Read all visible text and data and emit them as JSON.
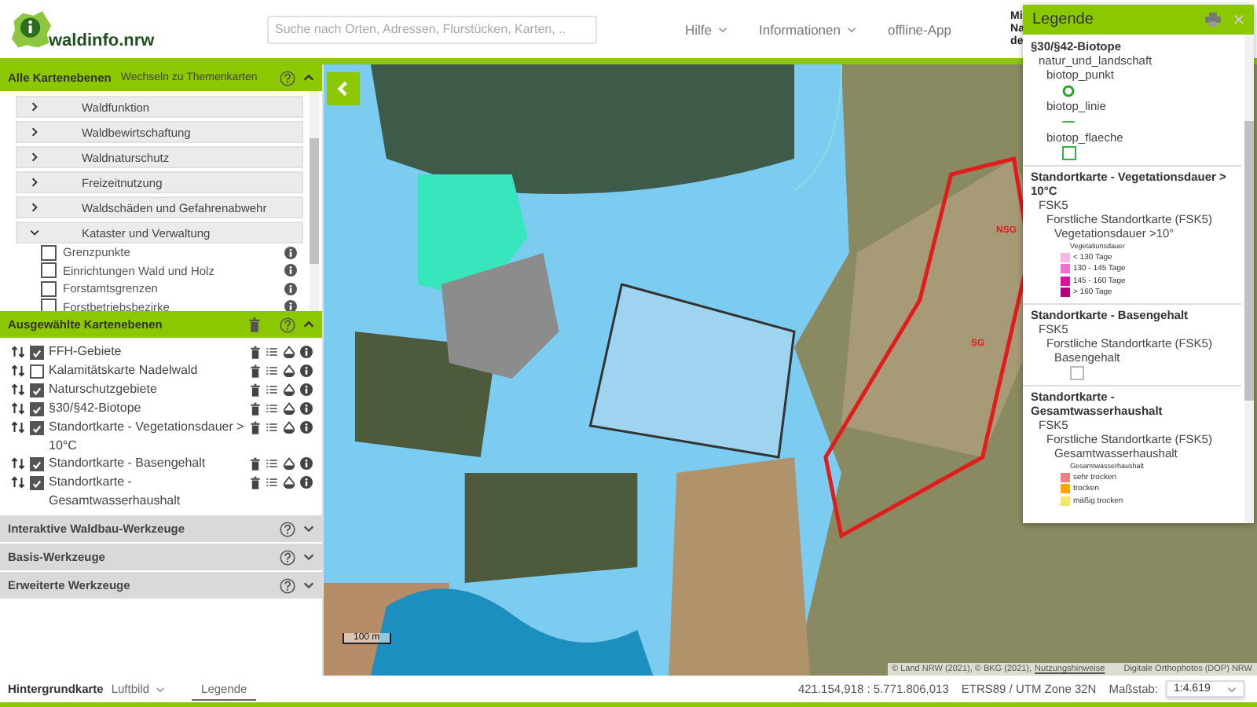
{
  "header": {
    "logo_text": "waldinfo.nrw",
    "search": {
      "placeholder": "Suche nach Orten, Adressen, Flurstücken, Karten, .."
    },
    "nav": [
      {
        "label": "Hilfe",
        "dropdown": true
      },
      {
        "label": "Informationen",
        "dropdown": true
      },
      {
        "label": "offline-App",
        "dropdown": false
      }
    ],
    "cut_text": [
      "Mi",
      "Na",
      "de"
    ]
  },
  "layer_panel": {
    "title": "Alle Kartenebenen",
    "switch_link": "Wechseln zu Themenkarten",
    "expanded": true,
    "categories": [
      {
        "label": "Waldfunktion",
        "expanded": false
      },
      {
        "label": "Waldbewirtschaftung",
        "expanded": false
      },
      {
        "label": "Waldnaturschutz",
        "expanded": false
      },
      {
        "label": "Freizeitnutzung",
        "expanded": false
      },
      {
        "label": "Waldschäden und Gefahrenabwehr",
        "expanded": false
      },
      {
        "label": "Kataster und Verwaltung",
        "expanded": true,
        "children": [
          {
            "label": "Grenzpunkte",
            "checked": false
          },
          {
            "label": "Einrichtungen Wald und Holz",
            "checked": false
          },
          {
            "label": "Forstamtsgrenzen",
            "checked": false
          },
          {
            "label": "Forstbetriebsbezirke",
            "checked": false
          }
        ]
      }
    ]
  },
  "selected_panel": {
    "title": "Ausgewählte Kartenebenen",
    "expanded": true,
    "layers": [
      {
        "label": "FFH-Gebiete",
        "checked": true
      },
      {
        "label": "Kalamitätskarte Nadelwald",
        "checked": false
      },
      {
        "label": "Naturschutzgebiete",
        "checked": true
      },
      {
        "label": "§30/§42-Biotope",
        "checked": true
      },
      {
        "label": "Standortkarte - Vegetationsdauer > 10°C",
        "checked": true
      },
      {
        "label": "Standortkarte - Basengehalt",
        "checked": true
      },
      {
        "label": "Standortkarte - Gesamtwasserhaushalt",
        "checked": true
      }
    ]
  },
  "tool_sections": [
    {
      "title": "Interaktive Waldbau-Werkzeuge",
      "expanded": false
    },
    {
      "title": "Basis-Werkzeuge",
      "expanded": false
    },
    {
      "title": "Erweiterte Werkzeuge",
      "expanded": false
    }
  ],
  "map": {
    "scale_bar": "100 m",
    "attribution": "© Land NRW (2021), © BKG (2021),",
    "terms_link": "Nutzungshinweise",
    "imagery_credit": "Digitale Orthophotos (DOP) NRW",
    "labels": [
      {
        "text": "NSG"
      },
      {
        "text": "SG"
      }
    ]
  },
  "legend": {
    "title": "Legende",
    "sections": [
      {
        "label": "§30/§42-Biotope",
        "children": [
          {
            "label": "natur_und_landschaft",
            "children": [
              {
                "label": "biotop_punkt",
                "kind": "circle"
              },
              {
                "label": "biotop_linie",
                "kind": "line"
              },
              {
                "label": "biotop_flaeche",
                "kind": "square"
              }
            ]
          }
        ]
      },
      {
        "label": "Standortkarte - Vegetationsdauer > 10°C",
        "children": [
          {
            "label": "FSK5",
            "children": [
              {
                "label": "Forstliche Standortkarte (FSK5)",
                "children": [
                  {
                    "label": "Vegetationsdauer >10°",
                    "swatches": {
                      "title": "Vegetationsdauer",
                      "items": [
                        {
                          "label": "< 130 Tage",
                          "color": "#f7b6e6"
                        },
                        {
                          "label": "130 - 145 Tage",
                          "color": "#ee6fd0"
                        },
                        {
                          "label": "145 - 160 Tage",
                          "color": "#e0109f"
                        },
                        {
                          "label": "> 160 Tage",
                          "color": "#b4007a"
                        }
                      ]
                    }
                  }
                ]
              }
            ]
          }
        ]
      },
      {
        "label": "Standortkarte - Basengehalt",
        "children": [
          {
            "label": "FSK5",
            "children": [
              {
                "label": "Forstliche Standortkarte (FSK5)",
                "children": [
                  {
                    "label": "Basengehalt",
                    "kind": "empty"
                  }
                ]
              }
            ]
          }
        ]
      },
      {
        "label": "Standortkarte - Gesamtwasserhaushalt",
        "children": [
          {
            "label": "FSK5",
            "children": [
              {
                "label": "Forstliche Standortkarte (FSK5)",
                "children": [
                  {
                    "label": "Gesamtwasserhaushalt",
                    "swatches": {
                      "title": "Gesamtwasserhaushalt",
                      "items": [
                        {
                          "label": "sehr trocken",
                          "color": "#f08080"
                        },
                        {
                          "label": "trocken",
                          "color": "#ffa500"
                        },
                        {
                          "label": "mäßig trocken",
                          "color": "#f5e66e"
                        }
                      ]
                    }
                  }
                ]
              }
            ]
          }
        ]
      }
    ]
  },
  "footer": {
    "background_label": "Hintergrundkarte",
    "background_value": "Luftbild",
    "tabs": [
      {
        "label": "Legende",
        "selected": true
      }
    ],
    "coordinates": "421.154,918 : 5.771.806,013",
    "crs": "ETRS89 / UTM Zone 32N",
    "scale_label": "Maßstab:",
    "scale_value": "1:4.619"
  }
}
